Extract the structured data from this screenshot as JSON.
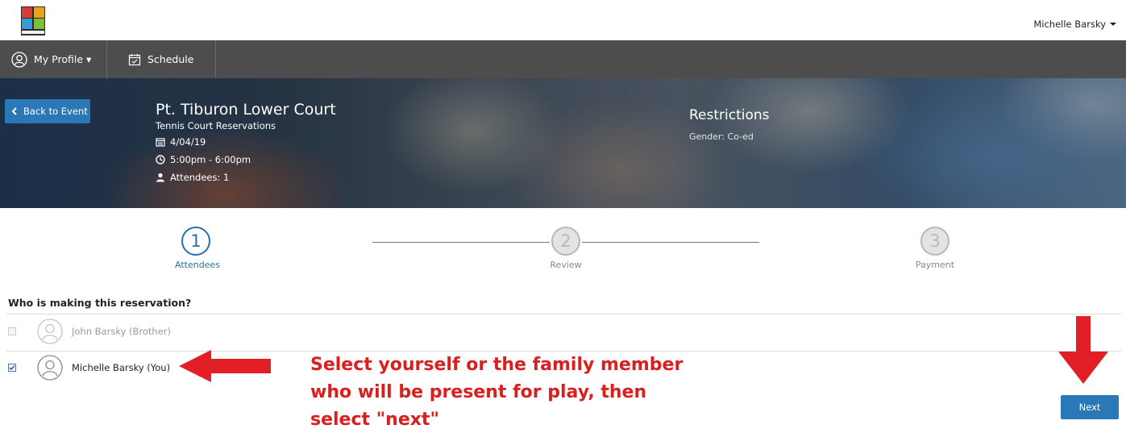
{
  "header": {
    "user_name": "Michelle Barsky"
  },
  "nav": {
    "profile_label": "My Profile ▾",
    "schedule_label": "Schedule"
  },
  "event": {
    "back_label": "Back to Event",
    "title": "Pt. Tiburon Lower Court",
    "subtitle": "Tennis Court Reservations",
    "date": "4/04/19",
    "time": "5:00pm - 6:00pm",
    "attendees": "Attendees: 1",
    "restrictions_title": "Restrictions",
    "restrictions_text": "Gender: Co-ed"
  },
  "steps": [
    {
      "number": "1",
      "label": "Attendees",
      "state": "active"
    },
    {
      "number": "2",
      "label": "Review",
      "state": "inactive"
    },
    {
      "number": "3",
      "label": "Payment",
      "state": "inactive"
    }
  ],
  "attendees_section": {
    "title": "Who is making this reservation?",
    "people": [
      {
        "name": "John Barsky (Brother)",
        "checked": false,
        "enabled": false
      },
      {
        "name": "Michelle Barsky (You)",
        "checked": true,
        "enabled": true
      }
    ]
  },
  "annotation": {
    "line1": "Select yourself or the family member",
    "line2": "who will be present for play, then",
    "line3": "select \"next\"",
    "color": "#d9201f"
  },
  "actions": {
    "next_label": "Next"
  },
  "colors": {
    "primary": "#2a78b5",
    "nav_bg": "#4d4d4d",
    "step_active": "#2a6fa8"
  }
}
